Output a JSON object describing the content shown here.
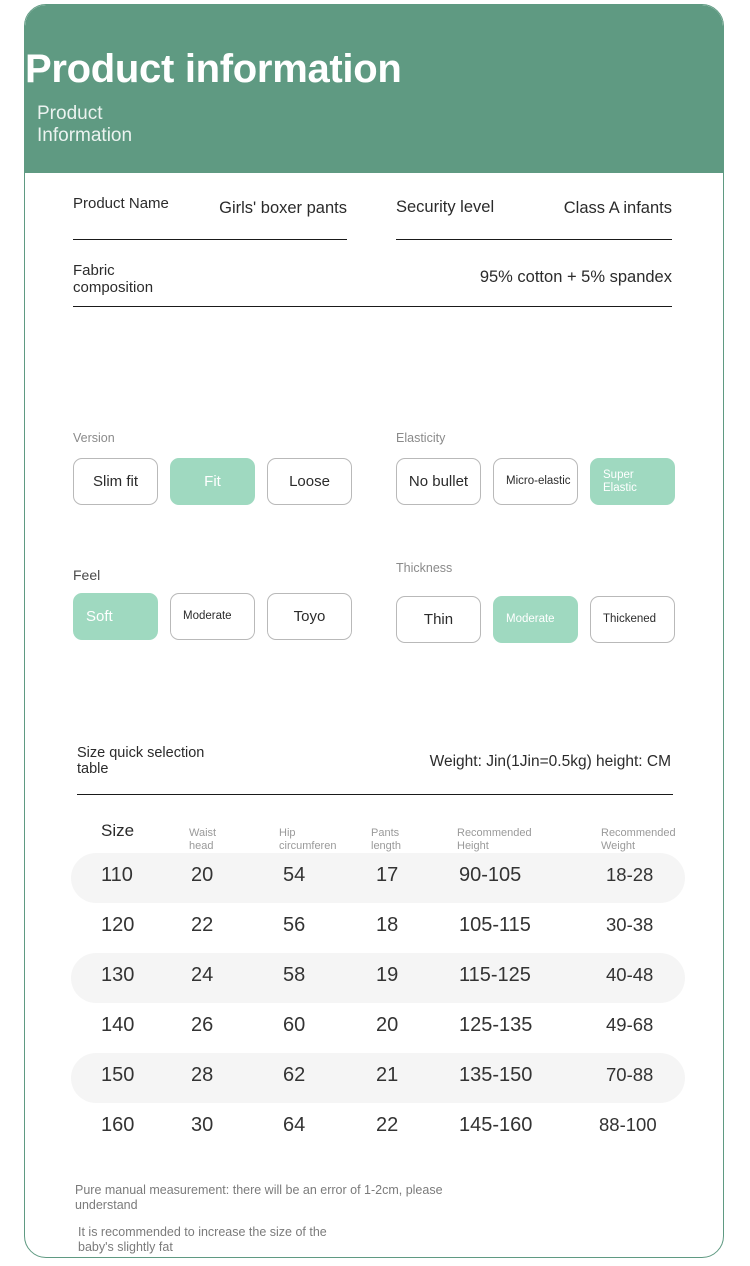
{
  "header": {
    "title": "Product information",
    "subtitle": "Product Information"
  },
  "info": {
    "product_name_label": "Product Name",
    "product_name_value": "Girls' boxer pants",
    "security_level_label": "Security level",
    "security_level_value": "Class A infants",
    "fabric_label": "Fabric composition",
    "fabric_value": "95% cotton + 5% spandex"
  },
  "options": {
    "version": {
      "title": "Version",
      "items": [
        {
          "label": "Slim fit",
          "selected": false
        },
        {
          "label": "Fit",
          "selected": true
        },
        {
          "label": "Loose",
          "selected": false
        }
      ]
    },
    "elasticity": {
      "title": "Elasticity",
      "items": [
        {
          "label": "No bullet",
          "selected": false
        },
        {
          "label": "Micro-elastic",
          "selected": false
        },
        {
          "label": "Super Elastic",
          "selected": true
        }
      ]
    },
    "feel": {
      "title": "Feel",
      "items": [
        {
          "label": "Soft",
          "selected": true
        },
        {
          "label": "Moderate",
          "selected": false
        },
        {
          "label": "Toyo",
          "selected": false
        }
      ]
    },
    "thickness": {
      "title": "Thickness",
      "items": [
        {
          "label": "Thin",
          "selected": false
        },
        {
          "label": "Moderate",
          "selected": true
        },
        {
          "label": "Thickened",
          "selected": false
        }
      ]
    }
  },
  "size_table": {
    "title": "Size quick selection table",
    "units_note": "Weight: Jin(1Jin=0.5kg) height: CM",
    "columns": [
      "Size",
      "Waist head",
      "Hip circumferen",
      "Pants length",
      "Recommended Height",
      "Recommended Weight"
    ],
    "rows": [
      [
        "110",
        "20",
        "54",
        "17",
        "90-105",
        "18-28"
      ],
      [
        "120",
        "22",
        "56",
        "18",
        "105-115",
        "30-38"
      ],
      [
        "130",
        "24",
        "58",
        "19",
        "115-125",
        "40-48"
      ],
      [
        "140",
        "26",
        "60",
        "20",
        "125-135",
        "49-68"
      ],
      [
        "150",
        "28",
        "62",
        "21",
        "135-150",
        "70-88"
      ],
      [
        "160",
        "30",
        "64",
        "22",
        "145-160",
        "88-100"
      ]
    ]
  },
  "notes": {
    "note1": "Pure manual measurement: there will be an error of 1-2cm, please understand",
    "note2": "It is recommended to increase the size of the baby's slightly fat"
  },
  "colors": {
    "header_green": "#5f9a82",
    "selected_green": "#9fd9c0",
    "stripe_gray": "#f5f5f5",
    "muted_text": "#9a9a9a"
  }
}
